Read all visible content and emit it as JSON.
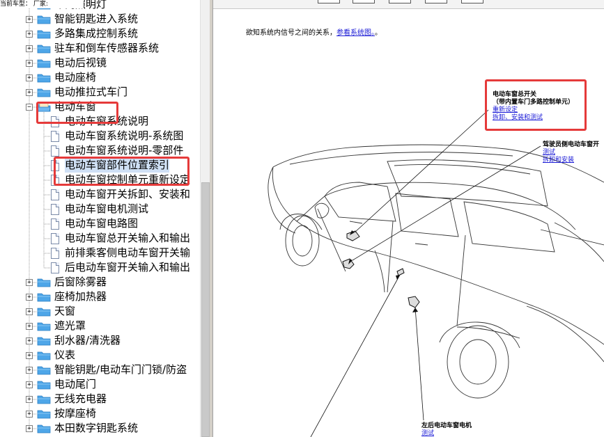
{
  "header": {
    "vehicle_label": "当前车型：",
    "maker_label": "厂家:"
  },
  "tree": {
    "nodes": [
      {
        "label": "车内照明灯",
        "level": 1,
        "kind": "folder",
        "expander": "+"
      },
      {
        "label": "智能钥匙进入系统",
        "level": 1,
        "kind": "folder",
        "expander": "+"
      },
      {
        "label": "多路集成控制系统",
        "level": 1,
        "kind": "folder",
        "expander": "+"
      },
      {
        "label": "驻车和倒车传感器系统",
        "level": 1,
        "kind": "folder",
        "expander": "+"
      },
      {
        "label": "电动后视镜",
        "level": 1,
        "kind": "folder",
        "expander": "+"
      },
      {
        "label": "电动座椅",
        "level": 1,
        "kind": "folder",
        "expander": "+"
      },
      {
        "label": "电动推拉式车门",
        "level": 1,
        "kind": "folder",
        "expander": "+"
      },
      {
        "label": "电动车窗",
        "level": 1,
        "kind": "folder-open",
        "expander": "−"
      },
      {
        "label": "电动车窗系统说明",
        "level": 2,
        "kind": "doc"
      },
      {
        "label": "电动车窗系统说明-系统图",
        "level": 2,
        "kind": "doc"
      },
      {
        "label": "电动车窗系统说明-零部件",
        "level": 2,
        "kind": "doc"
      },
      {
        "label": "电动车窗部件位置索引",
        "level": 2,
        "kind": "doc",
        "selected": true
      },
      {
        "label": "电动车窗控制单元重新设定",
        "level": 2,
        "kind": "doc"
      },
      {
        "label": "电动车窗开关拆卸、安装和",
        "level": 2,
        "kind": "doc"
      },
      {
        "label": "电动车窗电机测试",
        "level": 2,
        "kind": "doc"
      },
      {
        "label": "电动车窗电路图",
        "level": 2,
        "kind": "doc"
      },
      {
        "label": "电动车窗总开关输入和输出",
        "level": 2,
        "kind": "doc"
      },
      {
        "label": "前排乘客侧电动车窗开关输",
        "level": 2,
        "kind": "doc"
      },
      {
        "label": "后电动车窗开关输入和输出",
        "level": 2,
        "kind": "doc"
      },
      {
        "label": "后窗除雾器",
        "level": 1,
        "kind": "folder",
        "expander": "+"
      },
      {
        "label": "座椅加热器",
        "level": 1,
        "kind": "folder",
        "expander": "+"
      },
      {
        "label": "天窗",
        "level": 1,
        "kind": "folder",
        "expander": "+"
      },
      {
        "label": "遮光罩",
        "level": 1,
        "kind": "folder",
        "expander": "+"
      },
      {
        "label": "刮水器/清洗器",
        "level": 1,
        "kind": "folder",
        "expander": "+"
      },
      {
        "label": "仪表",
        "level": 1,
        "kind": "folder",
        "expander": "+"
      },
      {
        "label": "智能钥匙/电动车门门锁/防盗",
        "level": 1,
        "kind": "folder",
        "expander": "+"
      },
      {
        "label": "电动尾门",
        "level": 1,
        "kind": "folder",
        "expander": "+"
      },
      {
        "label": "无线充电器",
        "level": 1,
        "kind": "folder",
        "expander": "+"
      },
      {
        "label": "按摩座椅",
        "level": 1,
        "kind": "folder",
        "expander": "+"
      },
      {
        "label": "本田数字钥匙系统",
        "level": 1,
        "kind": "folder",
        "expander": "+"
      }
    ]
  },
  "content": {
    "intro_text": "欲知系统内信号之间的关系，",
    "intro_link": "参看系统图。",
    "intro_end": "。",
    "callouts": {
      "master_switch": {
        "title": "电动车窗总开关",
        "subtitle": "（带内置车门多路控制单元）",
        "link1": "重新设定",
        "link2": "拆卸、安装和测试"
      },
      "driver_switch": {
        "title": "驾驶员侧电动车窗开",
        "link1": "测试",
        "link2": "拆卸和安装"
      },
      "rear_left_motor": {
        "title": "左后电动车窗电机",
        "link1": "测试"
      }
    }
  },
  "colors": {
    "highlight_box": "#e53a3a",
    "link": "#1a1ad6",
    "folder": "#4ea6e8",
    "selected_bg": "#cfe0f5"
  }
}
